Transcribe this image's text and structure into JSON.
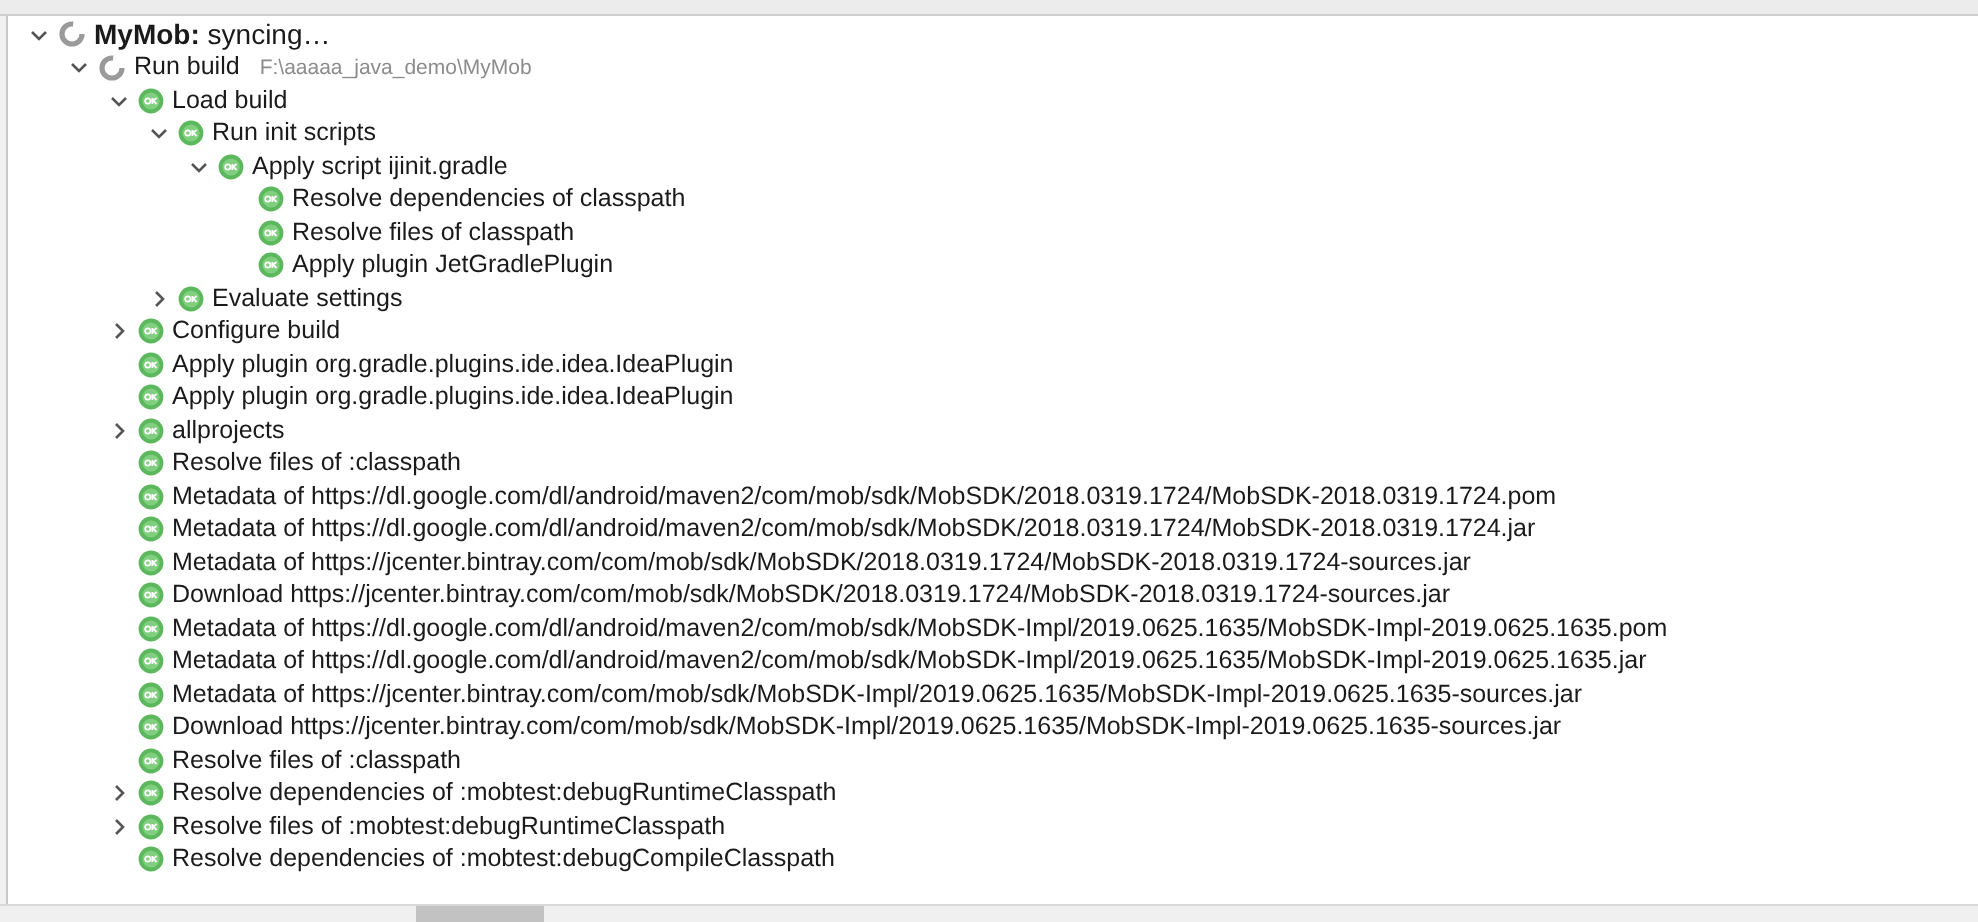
{
  "tree": [
    {
      "label": "**MyMob:** syncing…",
      "kind": "running",
      "expanded": true,
      "children": [
        {
          "label": "Run build",
          "detail": "F:\\aaaaa_java_demo\\MyMob",
          "kind": "running",
          "expanded": true,
          "children": [
            {
              "label": "Load build",
              "kind": "ok",
              "expanded": true,
              "children": [
                {
                  "label": "Run init scripts",
                  "kind": "ok",
                  "expanded": true,
                  "children": [
                    {
                      "label": "Apply script ijinit.gradle",
                      "kind": "ok",
                      "expanded": true,
                      "children": [
                        {
                          "label": "Resolve dependencies of classpath",
                          "kind": "ok"
                        },
                        {
                          "label": "Resolve files of classpath",
                          "kind": "ok"
                        },
                        {
                          "label": "Apply plugin JetGradlePlugin",
                          "kind": "ok"
                        }
                      ]
                    }
                  ]
                },
                {
                  "label": "Evaluate settings",
                  "kind": "ok",
                  "expanded": false
                }
              ]
            },
            {
              "label": "Configure build",
              "kind": "ok",
              "expanded": false
            },
            {
              "label": "Apply plugin org.gradle.plugins.ide.idea.IdeaPlugin",
              "kind": "ok"
            },
            {
              "label": "Apply plugin org.gradle.plugins.ide.idea.IdeaPlugin",
              "kind": "ok"
            },
            {
              "label": "allprojects",
              "kind": "ok",
              "expanded": false
            },
            {
              "label": "Resolve files of :classpath",
              "kind": "ok"
            },
            {
              "label": "Metadata of https://dl.google.com/dl/android/maven2/com/mob/sdk/MobSDK/2018.0319.1724/MobSDK-2018.0319.1724.pom",
              "kind": "ok"
            },
            {
              "label": "Metadata of https://dl.google.com/dl/android/maven2/com/mob/sdk/MobSDK/2018.0319.1724/MobSDK-2018.0319.1724.jar",
              "kind": "ok"
            },
            {
              "label": "Metadata of https://jcenter.bintray.com/com/mob/sdk/MobSDK/2018.0319.1724/MobSDK-2018.0319.1724-sources.jar",
              "kind": "ok"
            },
            {
              "label": "Download https://jcenter.bintray.com/com/mob/sdk/MobSDK/2018.0319.1724/MobSDK-2018.0319.1724-sources.jar",
              "kind": "ok"
            },
            {
              "label": "Metadata of https://dl.google.com/dl/android/maven2/com/mob/sdk/MobSDK-Impl/2019.0625.1635/MobSDK-Impl-2019.0625.1635.pom",
              "kind": "ok"
            },
            {
              "label": "Metadata of https://dl.google.com/dl/android/maven2/com/mob/sdk/MobSDK-Impl/2019.0625.1635/MobSDK-Impl-2019.0625.1635.jar",
              "kind": "ok"
            },
            {
              "label": "Metadata of https://jcenter.bintray.com/com/mob/sdk/MobSDK-Impl/2019.0625.1635/MobSDK-Impl-2019.0625.1635-sources.jar",
              "kind": "ok"
            },
            {
              "label": "Download https://jcenter.bintray.com/com/mob/sdk/MobSDK-Impl/2019.0625.1635/MobSDK-Impl-2019.0625.1635-sources.jar",
              "kind": "ok"
            },
            {
              "label": "Resolve files of :classpath",
              "kind": "ok"
            },
            {
              "label": "Resolve dependencies of :mobtest:debugRuntimeClasspath",
              "kind": "ok",
              "expanded": false
            },
            {
              "label": "Resolve files of :mobtest:debugRuntimeClasspath",
              "kind": "ok",
              "expanded": false
            },
            {
              "label": "Resolve dependencies of :mobtest:debugCompileClasspath",
              "kind": "ok"
            }
          ]
        }
      ]
    }
  ]
}
